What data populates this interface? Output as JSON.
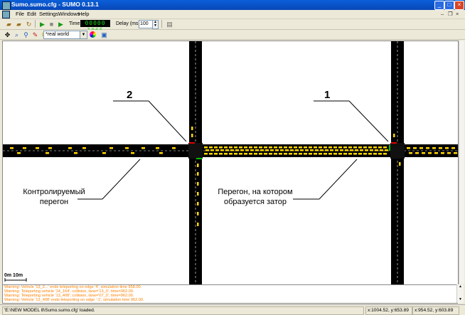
{
  "window": {
    "title": "Sumo.sumo.cfg - SUMO 0.13.1"
  },
  "menu": [
    "File",
    "Edit",
    "Settings",
    "Windows",
    "Help"
  ],
  "toolbar": {
    "time_label": "Time:",
    "time_value": "00000 1065",
    "delay_label": "Delay (ms):",
    "delay_value": "100"
  },
  "view_toolbar": {
    "scheme": "*real world"
  },
  "canvas": {
    "labels": {
      "node_2": "2",
      "node_1": "1",
      "left_annot_line1": "Контролируемый",
      "left_annot_line2": "перегон",
      "right_annot_line1": "Перегон, на котором",
      "right_annot_line2": "образуется затор"
    },
    "scale_label": "0m  10m"
  },
  "messages": [
    "Warning: Vehicle '13_2...' ends teleporting on edge '4', simulation time 958.00.",
    "Warning: Teleporting vehicle '14_164'; collision, lane='13_0', time=962.00.",
    "Warning: Teleporting vehicle '13_408'; collision, lane='07_0', time=962.00.",
    "Warning: Vehicle '13_408' ends teleporting on edge '-1', simulation time 962.00."
  ],
  "status": {
    "message": "'E:\\NEW MODEL 8\\Sumo.sumo.cfg' loaded.",
    "coord1": "x:1004.52, y:653.89",
    "coord2": "x:954.52, y:603.89"
  },
  "colors": {
    "titlebar": "#0847b8",
    "lcd_text": "#1fd31f",
    "warning": "#ff8000",
    "vehicle": "#ffd800"
  }
}
